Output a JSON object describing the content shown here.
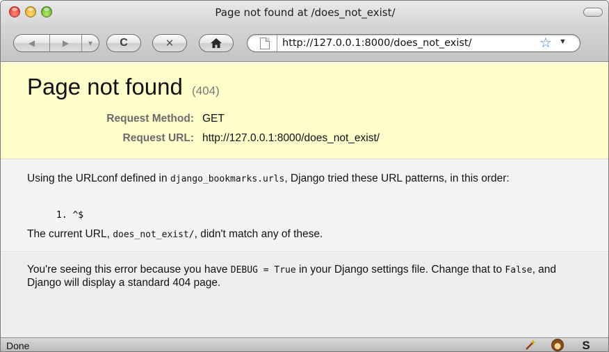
{
  "window": {
    "title": "Page not found at /does_not_exist/"
  },
  "toolbar": {
    "back_icon": "◀",
    "forward_icon": "▶",
    "history_dropdown_icon": "▾",
    "reload_icon": "C",
    "stop_icon": "✕",
    "home_icon": "⌂",
    "url": "http://127.0.0.1:8000/does_not_exist/",
    "bookmark_icon": "☆",
    "url_dropdown_icon": "▼"
  },
  "page": {
    "heading": "Page not found",
    "status_code": "(404)",
    "request_method_label": "Request Method:",
    "request_method_value": "GET",
    "request_url_label": "Request URL:",
    "request_url_value": "http://127.0.0.1:8000/does_not_exist/",
    "urlconf_text_1": "Using the URLconf defined in ",
    "urlconf_module": "django_bookmarks.urls",
    "urlconf_text_2": ", Django tried these URL patterns, in this order:",
    "patterns": [
      "1.  ^$"
    ],
    "nomatch_text_1": "The current URL, ",
    "nomatch_path": "does_not_exist/",
    "nomatch_text_2": ", didn't match any of these.",
    "debug_text_1": "You're seeing this error because you have ",
    "debug_setting": "DEBUG = True",
    "debug_text_2": " in your Django settings file. Change that to ",
    "debug_false": "False",
    "debug_text_3": ", and Django will display a standard 404 page."
  },
  "statusbar": {
    "text": "Done",
    "s_icon": "S"
  },
  "colors": {
    "summary_bg": "#ffffcc",
    "body_bg": "#f4f4f4",
    "star": "#3b7bd6"
  }
}
